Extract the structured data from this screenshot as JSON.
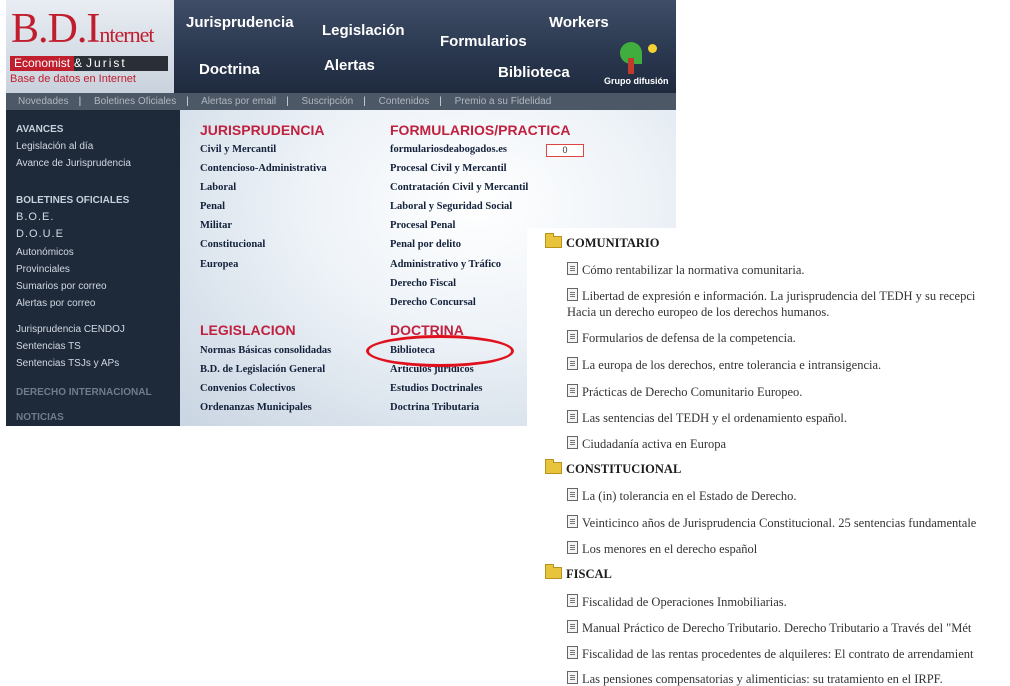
{
  "header": {
    "logo": {
      "bd": "B.D.",
      "i": "I",
      "nternet": "nternet",
      "economist": "Economist",
      "amp": "&",
      "jurist": "Jurist",
      "subtitle": "Base de datos en Internet"
    },
    "nav": {
      "jurisprudencia": "Jurisprudencia",
      "legislacion": "Legislación",
      "workers": "Workers",
      "formularios": "Formularios",
      "doctrina": "Doctrina",
      "alertas": "Alertas",
      "biblioteca": "Biblioteca"
    },
    "grupo": "Grupo difusión"
  },
  "subnav": [
    "Novedades",
    "Boletines Oficiales",
    "Alertas por email",
    "Suscripción",
    "Contenidos",
    "Premio a su Fidelidad"
  ],
  "sidebar": {
    "avances": "AVANCES",
    "legislacion_dia": "Legislación al día",
    "avance_juris": "Avance de Jurisprudencia",
    "boletines": "BOLETINES OFICIALES",
    "boe": "B.O.E.",
    "doue": "D.O.U.E",
    "autonomicos": "Autonómicos",
    "provinciales": "Provinciales",
    "sumarios": "Sumarios por correo",
    "alertas": "Alertas por correo",
    "cendoj": "Jurisprudencia CENDOJ",
    "sentencias_ts": "Sentencias TS",
    "sentencias_tsj": "Sentencias TSJs y APs",
    "derecho_int": "DERECHO INTERNACIONAL",
    "noticias": "NOTICIAS"
  },
  "content": {
    "jurisprudencia": {
      "title": "JURISPRUDENCIA",
      "links": [
        "Civil y Mercantil",
        "Contencioso-Administrativa",
        "Laboral",
        "Penal",
        "Militar",
        "Constitucional",
        "Europea"
      ]
    },
    "formularios": {
      "title": "FORMULARIOS/PRACTICA",
      "links": [
        "formulariosdeabogados.es",
        "Procesal Civil y Mercantil",
        "Contratación Civil y Mercantil",
        "Laboral y Seguridad Social",
        "Procesal Penal",
        "Penal por delito",
        "Administrativo y Tráfico",
        "Derecho Fiscal",
        "Derecho Concursal"
      ],
      "counter": "0"
    },
    "legislacion": {
      "title": "LEGISLACION",
      "links": [
        "Normas Básicas consolidadas",
        "B.D. de Legislación General",
        "Convenios Colectivos",
        "Ordenanzas Municipales"
      ]
    },
    "doctrina": {
      "title": "DOCTRINA",
      "links": [
        "Biblioteca",
        "Artículos jurídicos",
        "Estudios Doctrinales",
        "Doctrina Tributaria"
      ]
    }
  },
  "library": {
    "comunitario": {
      "title": "COMUNITARIO",
      "docs": [
        "Cómo rentabilizar la normativa comunitaria.",
        "Libertad de expresión e información. La jurisprudencia del TEDH y su recepci",
        "Hacia un derecho europeo de los derechos humanos.",
        "Formularios de defensa de la competencia.",
        "La europa de los derechos, entre tolerancia e intransigencia.",
        "Prácticas de Derecho Comunitario Europeo.",
        "Las sentencias del TEDH y el ordenamiento español.",
        "Ciudadanía activa en Europa"
      ]
    },
    "constitucional": {
      "title": "CONSTITUCIONAL",
      "docs": [
        "La (in) tolerancia en el Estado de Derecho.",
        "Veinticinco años de Jurisprudencia Constitucional. 25 sentencias fundamentale",
        "Los menores en el derecho español"
      ]
    },
    "fiscal": {
      "title": "FISCAL",
      "docs": [
        "Fiscalidad de Operaciones Inmobiliarias.",
        "Manual Práctico de Derecho Tributario. Derecho Tributario a Través del \"Mét",
        "Fiscalidad de las rentas procedentes de alquileres: El contrato de arrendamient",
        "Las pensiones compensatorias y alimenticias: su tratamiento en el IRPF."
      ]
    }
  }
}
